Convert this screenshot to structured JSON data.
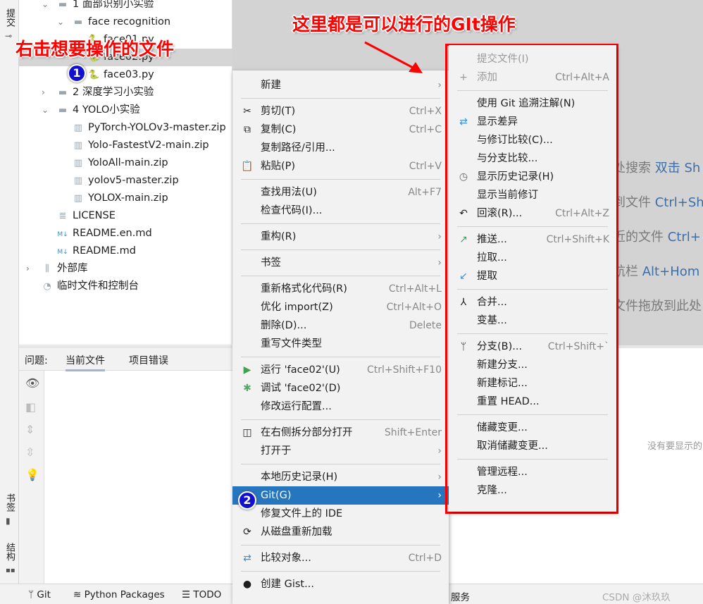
{
  "left_strip": {
    "commit": "提交",
    "bookmarks": "书签",
    "structure": "结构"
  },
  "tree": [
    {
      "label": "1 面部识别小实验",
      "icon": "folder-icon",
      "chev": "⌄",
      "indent": 1
    },
    {
      "label": "face recognition",
      "icon": "folder-icon",
      "chev": "⌄",
      "indent": 2
    },
    {
      "label": "face01.py",
      "icon": "python-file-icon",
      "indent": 3
    },
    {
      "label": "face02.py",
      "icon": "python-file-icon",
      "indent": 3,
      "selected": true
    },
    {
      "label": "face03.py",
      "icon": "python-file-icon",
      "indent": 3
    },
    {
      "label": "2 深度学习小实验",
      "icon": "folder-icon",
      "chev": "›",
      "indent": 1
    },
    {
      "label": "4 YOLO小实验",
      "icon": "folder-icon",
      "chev": "⌄",
      "indent": 1
    },
    {
      "label": "PyTorch-YOLOv3-master.zip",
      "icon": "zip-icon",
      "indent": 2
    },
    {
      "label": "Yolo-FastestV2-main.zip",
      "icon": "zip-icon",
      "indent": 2
    },
    {
      "label": "YoloAll-main.zip",
      "icon": "zip-icon",
      "indent": 2
    },
    {
      "label": "yolov5-master.zip",
      "icon": "zip-icon",
      "indent": 2
    },
    {
      "label": "YOLOX-main.zip",
      "icon": "zip-icon",
      "indent": 2
    },
    {
      "label": "LICENSE",
      "icon": "text-file-icon",
      "indent": 1
    },
    {
      "label": "README.en.md",
      "icon": "markdown-icon",
      "indent": 1
    },
    {
      "label": "README.md",
      "icon": "markdown-icon",
      "indent": 1
    },
    {
      "label": "外部库",
      "icon": "library-icon",
      "chev": "›",
      "indent": 0
    },
    {
      "label": "临时文件和控制台",
      "icon": "scratch-icon",
      "indent": 0
    }
  ],
  "editor_hints": [
    {
      "text": "处搜索",
      "key": "双击 Sh"
    },
    {
      "text": "到文件",
      "key": "Ctrl+Sh"
    },
    {
      "text": "近的文件",
      "key": "Ctrl+"
    },
    {
      "text": "航栏",
      "key": "Alt+Hom"
    },
    {
      "text": "文件拖放到此处",
      "key": ""
    }
  ],
  "problems": {
    "label": "问题:",
    "tabs": [
      "当前文件",
      "项目错误"
    ],
    "empty_text": "没有要显示的"
  },
  "status_bar": {
    "git": "Git",
    "python_packages": "Python Packages",
    "todo": "TODO",
    "services": "服务",
    "watermark": "CSDN @沐玖玖"
  },
  "context_menu": [
    {
      "label": "新建",
      "submenu": true
    },
    "sep",
    {
      "label": "剪切(T)",
      "icon": "✂",
      "name": "cut",
      "shortcut": "Ctrl+X"
    },
    {
      "label": "复制(C)",
      "icon": "⧉",
      "name": "copy",
      "shortcut": "Ctrl+C"
    },
    {
      "label": "复制路径/引用..."
    },
    {
      "label": "粘贴(P)",
      "icon": "📋",
      "name": "paste",
      "shortcut": "Ctrl+V"
    },
    "sep",
    {
      "label": "查找用法(U)",
      "shortcut": "Alt+F7"
    },
    {
      "label": "检查代码(I)..."
    },
    "sep",
    {
      "label": "重构(R)",
      "submenu": true
    },
    "sep",
    {
      "label": "书签",
      "submenu": true
    },
    "sep",
    {
      "label": "重新格式化代码(R)",
      "shortcut": "Ctrl+Alt+L"
    },
    {
      "label": "优化 import(Z)",
      "shortcut": "Ctrl+Alt+O"
    },
    {
      "label": "删除(D)...",
      "shortcut": "Delete"
    },
    {
      "label": "重写文件类型"
    },
    "sep",
    {
      "label": "运行 'face02'(U)",
      "icon": "▶",
      "name": "run",
      "color": "#3fa34d",
      "shortcut": "Ctrl+Shift+F10"
    },
    {
      "label": "调试 'face02'(D)",
      "icon": "✱",
      "name": "debug",
      "color": "#59a869"
    },
    {
      "label": "修改运行配置..."
    },
    "sep",
    {
      "label": "在右侧拆分部分打开",
      "icon": "◫",
      "name": "split",
      "shortcut": "Shift+Enter"
    },
    {
      "label": "打开于",
      "submenu": true
    },
    "sep",
    {
      "label": "本地历史记录(H)",
      "submenu": true
    },
    {
      "label": "Git(G)",
      "submenu": true,
      "highlighted": true
    },
    {
      "label": "修复文件上的 IDE"
    },
    {
      "label": "从磁盘重新加载",
      "icon": "⟳",
      "name": "reload"
    },
    "sep",
    {
      "label": "比较对象...",
      "icon": "⇄",
      "name": "compare",
      "color": "#3d8fd6",
      "shortcut": "Ctrl+D"
    },
    "sep",
    {
      "label": "创建 Gist...",
      "icon": "●",
      "name": "github"
    }
  ],
  "git_submenu": [
    {
      "label": "提交文件(I)",
      "disabled": true
    },
    {
      "label": "添加",
      "icon": "+",
      "name": "add",
      "disabled": true,
      "shortcut": "Ctrl+Alt+A"
    },
    "sep",
    {
      "label": "使用 Git 追溯注解(N)"
    },
    {
      "label": "显示差异",
      "icon": "⇄",
      "name": "diff",
      "color": "#3d8fd6"
    },
    {
      "label": "与修订比较(C)..."
    },
    {
      "label": "与分支比较..."
    },
    {
      "label": "显示历史记录(H)",
      "icon": "◷",
      "name": "history",
      "color": "#666"
    },
    {
      "label": "显示当前修订"
    },
    {
      "label": "回滚(R)...",
      "icon": "↶",
      "name": "rollback",
      "shortcut": "Ctrl+Alt+Z"
    },
    "sep",
    {
      "label": "推送...",
      "icon": "↗",
      "name": "push",
      "color": "#3fa34d",
      "shortcut": "Ctrl+Shift+K"
    },
    {
      "label": "拉取..."
    },
    {
      "label": "提取",
      "icon": "↙",
      "name": "fetch",
      "color": "#3d8fd6"
    },
    "sep",
    {
      "label": "合并...",
      "icon": "⅄",
      "name": "merge"
    },
    {
      "label": "变基..."
    },
    "sep",
    {
      "label": "分支(B)...",
      "icon": "ᛘ",
      "name": "branch",
      "shortcut": "Ctrl+Shift+`"
    },
    {
      "label": "新建分支..."
    },
    {
      "label": "新建标记..."
    },
    {
      "label": "重置 HEAD..."
    },
    "sep",
    {
      "label": "储藏变更..."
    },
    {
      "label": "取消储藏变更..."
    },
    "sep",
    {
      "label": "管理远程..."
    },
    {
      "label": "克隆..."
    }
  ],
  "annotations": {
    "right_click": "右击想要操作的文件",
    "git_ops": "这里都是可以进行的GIt操作",
    "step1": "1",
    "step2": "2"
  },
  "colors": {
    "highlight": "#2675bf",
    "annotation": "#ff0000",
    "badge": "#1010d0"
  }
}
